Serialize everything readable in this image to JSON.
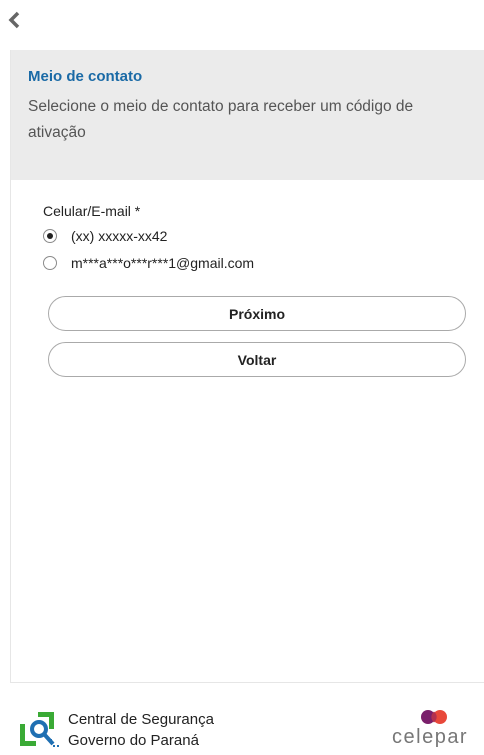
{
  "header": {
    "back_icon": "chevron-left-icon"
  },
  "panel": {
    "title": "Meio de contato",
    "description": "Selecione o meio de contato para receber um código de ativação"
  },
  "form": {
    "field_label": "Celular/E-mail *",
    "options": [
      {
        "label": "(xx) xxxxx-xx42",
        "selected": true
      },
      {
        "label": "m***a***o***r***1@gmail.com",
        "selected": false
      }
    ],
    "next_label": "Próximo",
    "back_label": "Voltar"
  },
  "footer": {
    "line1": "Central de Segurança",
    "line2": "Governo do Paraná",
    "brand": "celepar"
  },
  "colors": {
    "accent": "#1a6aa6",
    "panel_bg": "#ebebeb",
    "logo_green": "#3aaa35",
    "logo_blue": "#1f6fb2",
    "brand_purple": "#7a1f6b",
    "brand_red": "#e8483a"
  }
}
